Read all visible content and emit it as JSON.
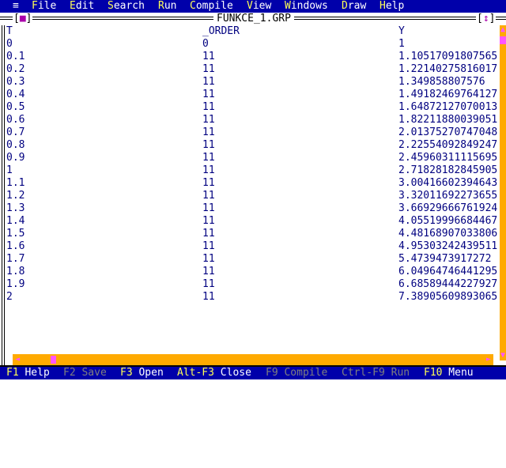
{
  "menu": {
    "system_icon": "≡",
    "items": [
      {
        "hot": "F",
        "rest": "ile"
      },
      {
        "hot": "E",
        "rest": "dit"
      },
      {
        "hot": "S",
        "rest": "earch"
      },
      {
        "hot": "R",
        "rest": "un"
      },
      {
        "hot": "C",
        "rest": "ompile"
      },
      {
        "hot": "V",
        "rest": "iew"
      },
      {
        "hot": "W",
        "rest": "indows"
      },
      {
        "hot": "D",
        "rest": "raw"
      },
      {
        "hot": "H",
        "rest": "elp"
      }
    ]
  },
  "window": {
    "title": "FUNKCE_1.GRP",
    "close_box": "■",
    "zoom_box": "↕",
    "columns": [
      "T",
      "_ORDER",
      "Y"
    ],
    "rows": [
      [
        "0",
        "0",
        "1"
      ],
      [
        "0.1",
        "11",
        "1.10517091807565"
      ],
      [
        "0.2",
        "11",
        "1.22140275816017"
      ],
      [
        "0.3",
        "11",
        "1.349858807576"
      ],
      [
        "0.4",
        "11",
        "1.49182469764127"
      ],
      [
        "0.5",
        "11",
        "1.64872127070013"
      ],
      [
        "0.6",
        "11",
        "1.82211880039051"
      ],
      [
        "0.7",
        "11",
        "2.01375270747048"
      ],
      [
        "0.8",
        "11",
        "2.22554092849247"
      ],
      [
        "0.9",
        "11",
        "2.45960311115695"
      ],
      [
        "1",
        "11",
        "2.71828182845905"
      ],
      [
        "1.1",
        "11",
        "3.00416602394643"
      ],
      [
        "1.2",
        "11",
        "3.32011692273655"
      ],
      [
        "1.3",
        "11",
        "3.66929666761924"
      ],
      [
        "1.4",
        "11",
        "4.05519996684467"
      ],
      [
        "1.5",
        "11",
        "4.48168907033806"
      ],
      [
        "1.6",
        "11",
        "4.95303242439511"
      ],
      [
        "1.7",
        "11",
        "5.4739473917272"
      ],
      [
        "1.8",
        "11",
        "6.04964746441295"
      ],
      [
        "1.9",
        "11",
        "6.68589444227927"
      ],
      [
        "2",
        "11",
        "7.38905609893065"
      ]
    ]
  },
  "scrollbars": {
    "up_arrow": "▲",
    "down_arrow": "▼",
    "left_arrow": "◄",
    "right_arrow": "►"
  },
  "status": {
    "items": [
      {
        "key": "F1",
        "label": " Help",
        "enabled": true
      },
      {
        "key": "F2",
        "label": " Save",
        "enabled": false
      },
      {
        "key": "F3",
        "label": " Open",
        "enabled": true
      },
      {
        "key": "Alt-F3",
        "label": " Close",
        "enabled": true
      },
      {
        "key": "F9",
        "label": " Compile",
        "enabled": false
      },
      {
        "key": "Ctrl-F9",
        "label": " Run",
        "enabled": false
      },
      {
        "key": "F10",
        "label": " Menu",
        "enabled": true
      }
    ]
  },
  "colors": {
    "bar_background": "#0000aa",
    "hotkey": "#ffff55",
    "content_text": "#000080",
    "scrollbar": "#ffaa00",
    "scroll_thumb": "#ff55ff",
    "disabled": "#7f7f7f"
  }
}
